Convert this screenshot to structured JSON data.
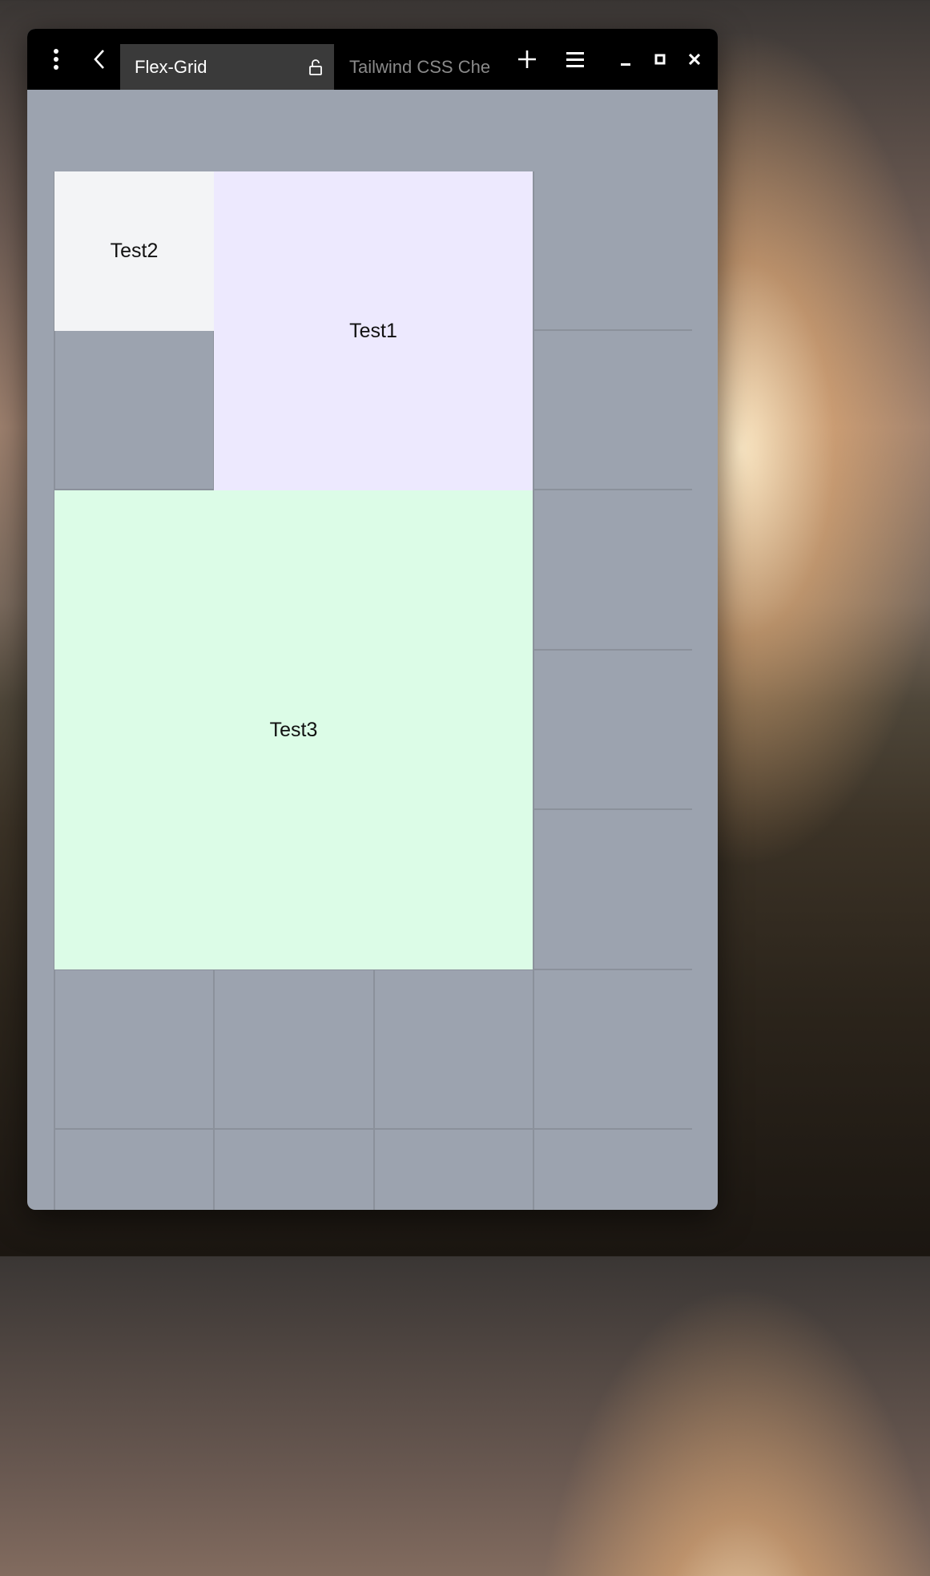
{
  "titlebar": {
    "tabs": [
      {
        "label": "Flex-Grid",
        "active": true,
        "icon": "unlock-icon"
      },
      {
        "label": "Tailwind CSS Che",
        "active": false
      }
    ],
    "icons": [
      "kebab-menu-icon",
      "back-arrow-icon",
      "new-tab-plus-icon",
      "hamburger-menu-icon",
      "minimize-icon",
      "maximize-icon",
      "close-icon"
    ]
  },
  "grid": {
    "items": [
      {
        "label": "Test1",
        "color": "#ede9fe"
      },
      {
        "label": "Test2",
        "color": "#f3f4f6"
      },
      {
        "label": "Test3",
        "color": "#dcfce7"
      }
    ],
    "background": "#9ca3af",
    "line_color": "#8b919b"
  }
}
